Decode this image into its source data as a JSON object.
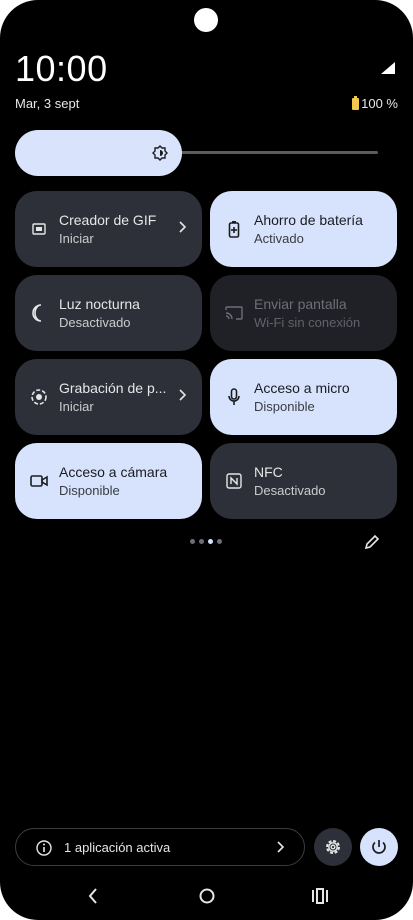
{
  "status": {
    "time": "10:00",
    "date": "Mar, 3 sept",
    "battery": "100 %"
  },
  "brightness": {
    "level": 0.46
  },
  "tiles": [
    {
      "title": "Creador de GIF",
      "subtitle": "Iniciar",
      "state": "inactive",
      "icon": "gif-icon",
      "has_chevron": true
    },
    {
      "title": "Ahorro de batería",
      "subtitle": "Activado",
      "state": "active",
      "icon": "battery-saver-icon",
      "has_chevron": false
    },
    {
      "title": "Luz nocturna",
      "subtitle": "Desactivado",
      "state": "inactive",
      "icon": "moon-icon",
      "has_chevron": false
    },
    {
      "title": "Enviar pantalla",
      "subtitle": "Wi-Fi sin conexión",
      "state": "unavailable",
      "icon": "cast-icon",
      "has_chevron": false
    },
    {
      "title": "Grabación de p...",
      "subtitle": "Iniciar",
      "state": "inactive",
      "icon": "screen-record-icon",
      "has_chevron": true
    },
    {
      "title": "Acceso a micro",
      "subtitle": "Disponible",
      "state": "active",
      "icon": "microphone-icon",
      "has_chevron": false
    },
    {
      "title": "Acceso a cámara",
      "subtitle": "Disponible",
      "state": "active",
      "icon": "video-camera-icon",
      "has_chevron": false
    },
    {
      "title": "NFC",
      "subtitle": "Desactivado",
      "state": "inactive",
      "icon": "nfc-icon",
      "has_chevron": false
    }
  ],
  "pagination": {
    "pages": 4,
    "current": 3
  },
  "footer": {
    "active_apps_label": "1 aplicación activa"
  },
  "colors": {
    "background": "#000000",
    "tile_active": "#d7e3fc",
    "tile_inactive": "#2d3038",
    "battery_accent": "#f2c94c"
  }
}
